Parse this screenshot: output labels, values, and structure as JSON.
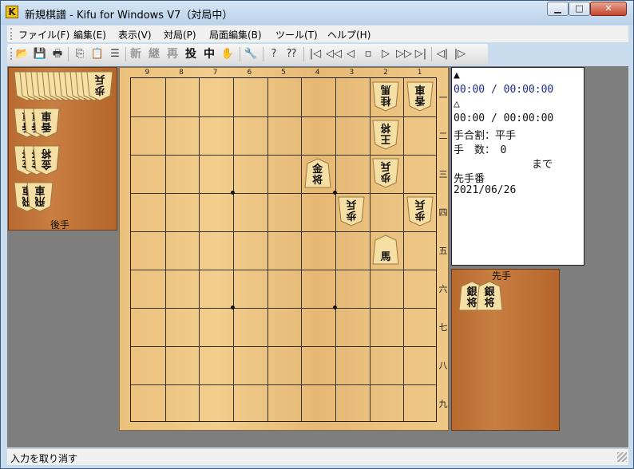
{
  "window": {
    "title": "新規棋譜 - Kifu for Windows V7（対局中）",
    "app_icon_letter": "K",
    "minimize_glyph": "▁",
    "maximize_glyph": "□",
    "close_glyph": "✕"
  },
  "menu": {
    "items": [
      "ファイル(F)",
      "編集(E)",
      "表示(V)",
      "対局(P)",
      "局面編集(B)",
      "ツール(T)",
      "ヘルプ(H)"
    ]
  },
  "toolbar": {
    "file_icons": [
      "open-icon",
      "save-icon",
      "print-icon"
    ],
    "edit_icons": [
      "copy-icon",
      "paste-icon",
      "notes-icon"
    ],
    "mode_labels": [
      "新",
      "継",
      "再",
      "投",
      "中"
    ],
    "tool_icons": [
      "hand-icon",
      "wrench-icon",
      "help-icon",
      "query-icon"
    ],
    "nav_icons": [
      "first-move-icon",
      "back-10-icon",
      "back-icon",
      "stop-icon",
      "forward-icon",
      "forward-10-icon",
      "last-move-icon",
      "branch-prev-icon",
      "branch-next-icon"
    ]
  },
  "board": {
    "file_labels": [
      "9",
      "8",
      "7",
      "6",
      "5",
      "4",
      "3",
      "2",
      "1"
    ],
    "rank_labels": [
      "一",
      "二",
      "三",
      "四",
      "五",
      "六",
      "七",
      "八",
      "九"
    ],
    "pieces": [
      {
        "owner": "gote",
        "file": 2,
        "rank": 1,
        "top": "桂",
        "bottom": "馬"
      },
      {
        "owner": "gote",
        "file": 1,
        "rank": 1,
        "top": "香",
        "bottom": "車"
      },
      {
        "owner": "gote",
        "file": 2,
        "rank": 2,
        "top": "王",
        "bottom": "将"
      },
      {
        "owner": "gote",
        "file": 2,
        "rank": 3,
        "top": "歩",
        "bottom": "兵"
      },
      {
        "owner": "sente",
        "file": 4,
        "rank": 3,
        "top": "金",
        "bottom": "将"
      },
      {
        "owner": "gote",
        "file": 3,
        "rank": 4,
        "top": "歩",
        "bottom": "兵"
      },
      {
        "owner": "gote",
        "file": 1,
        "rank": 4,
        "top": "歩",
        "bottom": "兵"
      },
      {
        "owner": "sente",
        "file": 2,
        "rank": 5,
        "top": "",
        "bottom": "馬"
      }
    ]
  },
  "hand_gote": {
    "label": "後手",
    "rows": [
      {
        "top": "歩",
        "bottom": "兵",
        "count": 14
      },
      {
        "top": "香",
        "bottom": "車",
        "count": 3
      },
      {
        "top": "金",
        "bottom": "将",
        "count": 3
      },
      {
        "top": "飛",
        "bottom": "車",
        "count": 2
      }
    ]
  },
  "hand_sente": {
    "label": "先手",
    "pieces": [
      {
        "top": "銀",
        "bottom": "将",
        "count": 2
      }
    ]
  },
  "info": {
    "sente_mark": "▲",
    "sente_time": "00:00 / 00:00:00",
    "gote_mark": "△",
    "gote_time": "00:00 / 00:00:00",
    "handicap": "手合割：平手",
    "moves": "手　数：　0",
    "made": "まで",
    "turn": "先手番",
    "date": "2021/06/26"
  },
  "status": {
    "text": "入力を取り消す"
  }
}
